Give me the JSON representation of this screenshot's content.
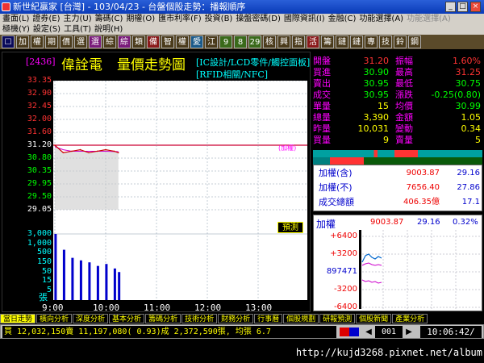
{
  "window": {
    "title": "新世紀贏家 [台灣] - 103/04/23 - 台盤個股走勢：播報順序",
    "btn_min": "_",
    "btn_max": "□",
    "btn_close": "×"
  },
  "menu1": [
    "畫面(L)",
    "證券(E)",
    "主力(U)",
    "籌碼(C)",
    "期權(O)",
    "匯市利率(F)",
    "投資(B)",
    "操盤密碼(D)",
    "國際資訊(I)",
    "金融(C)",
    "功能選擇(A)",
    "功能選擇(A)"
  ],
  "menu2": [
    "極機(Y)",
    "設定(S)",
    "工具(T)",
    "說明(H)"
  ],
  "toolbar": [
    {
      "t": "☐",
      "c": "#0a0a5a"
    },
    {
      "t": "加",
      "c": "#4a3a1a"
    },
    {
      "t": "權",
      "c": "#4a3a1a"
    },
    {
      "t": "期",
      "c": "#4a3a1a"
    },
    {
      "t": "價",
      "c": "#4a3a1a"
    },
    {
      "t": "選",
      "c": "#4a3a1a"
    },
    {
      "t": "選",
      "c": "#7a1a7a"
    },
    {
      "t": "綜",
      "c": "#4a3a1a"
    },
    {
      "t": "綜",
      "c": "#7a1a7a"
    },
    {
      "t": "類",
      "c": "#4a3a1a"
    },
    {
      "t": "備",
      "c": "#8a1a1a"
    },
    {
      "t": "智",
      "c": "#4a3a1a"
    },
    {
      "t": "權",
      "c": "#4a3a1a"
    },
    {
      "t": "愛",
      "c": "#1a5a8a"
    },
    {
      "t": "江",
      "c": "#4a3a1a"
    },
    {
      "t": "9",
      "c": "#3a6a1a"
    },
    {
      "t": "8",
      "c": "#3a6a1a"
    },
    {
      "t": "29",
      "c": "#3a6a1a"
    },
    {
      "t": "核",
      "c": "#4a3a1a"
    },
    {
      "t": "興",
      "c": "#4a3a1a"
    },
    {
      "t": "指",
      "c": "#4a3a1a"
    },
    {
      "t": "活",
      "c": "#8a1a1a"
    },
    {
      "t": "籌",
      "c": "#4a3a1a"
    },
    {
      "t": "鏈",
      "c": "#4a3a1a"
    },
    {
      "t": "鏈",
      "c": "#4a3a1a"
    },
    {
      "t": "專",
      "c": "#4a3a1a"
    },
    {
      "t": "技",
      "c": "#4a3a1a"
    },
    {
      "t": "鈴",
      "c": "#4a3a1a"
    },
    {
      "t": "鋼",
      "c": "#4a3a1a"
    }
  ],
  "chart": {
    "code": "[2436]",
    "name": "偉詮電",
    "title": "量價走勢圖",
    "tags1": "[IC設計/LCD零件/觸控面板]",
    "tags2": "[RFID相關/NFC]",
    "limit_label": "(加權)",
    "predict_label": "預測",
    "vol_unit": "張",
    "price_ticks": [
      "33.35",
      "32.90",
      "32.45",
      "32.00",
      "31.60",
      "31.20",
      "30.80",
      "30.35",
      "29.95",
      "29.50",
      "29.05"
    ],
    "vol_ticks": [
      "3,000",
      "1,000",
      "500",
      "150",
      "50",
      "15",
      "5"
    ],
    "times": [
      "9:00",
      "10:00",
      "11:00",
      "12:00",
      "13:00"
    ]
  },
  "chart_data": {
    "type": "line",
    "x": [
      "9:00",
      "9:10",
      "9:20",
      "9:30",
      "9:40",
      "9:50",
      "10:00",
      "10:10",
      "10:15"
    ],
    "series": [
      {
        "values": [
          31.2,
          30.95,
          31.0,
          31.05,
          30.95,
          31.0,
          31.05,
          31.0,
          30.95
        ]
      }
    ],
    "avg": [
      31.15,
      31.05,
      31.0,
      31.0,
      31.0,
      31.0,
      31.0,
      30.99,
      30.99
    ],
    "volume": [
      3000,
      500,
      200,
      150,
      120,
      80,
      100,
      60,
      40
    ],
    "ylim": [
      29.05,
      33.35
    ],
    "xlim": [
      "9:00",
      "13:30"
    ]
  },
  "stats": [
    {
      "l1": "開盤",
      "v1": "31.20",
      "c1": "#f33",
      "l2": "振幅",
      "v2": "1.60%",
      "c2": "#f33"
    },
    {
      "l1": "買進",
      "v1": "30.90",
      "c1": "#0f0",
      "l2": "最高",
      "v2": "31.25",
      "c2": "#f33"
    },
    {
      "l1": "賣出",
      "v1": "30.95",
      "c1": "#0f0",
      "l2": "最低",
      "v2": "30.75",
      "c2": "#0f0"
    },
    {
      "l1": "成交",
      "v1": "30.95",
      "c1": "#0f0",
      "l2": "漲跌",
      "v2": "-0.25(0.80)",
      "c2": "#0f0"
    },
    {
      "l1": "單量",
      "v1": "15",
      "c1": "#ff0",
      "l2": "均價",
      "v2": "30.99",
      "c2": "#0f0"
    },
    {
      "l1": "總量",
      "v1": "3,390",
      "c1": "#ff0",
      "l2": "金額",
      "v2": "1.05",
      "c2": "#ff0"
    },
    {
      "l1": "昨量",
      "v1": "10,031",
      "c1": "#ff0",
      "l2": "變動",
      "v2": "0.34",
      "c2": "#ff0"
    },
    {
      "l1": "買量",
      "v1": "9",
      "c1": "#ff0",
      "l2": "賣量",
      "v2": "5",
      "c2": "#ff0"
    }
  ],
  "index": [
    {
      "label": "加權(含)",
      "val": "9003.87",
      "chg": "29.16"
    },
    {
      "label": "加權(不)",
      "val": "7656.40",
      "chg": "27.86"
    },
    {
      "label": "成交總額",
      "val": "406.35億",
      "chg": "17.1"
    }
  ],
  "mini": {
    "label": "加權",
    "val": "9003.87",
    "chg": "29.16",
    "pct": "0.32%",
    "ticks": [
      "+6400",
      "+3200",
      "897471",
      "-3200",
      "-6400"
    ]
  },
  "tabs": [
    "當日走勢",
    "橫向分析",
    "深度分析",
    "基本分析",
    "籌碼分析",
    "技術分析",
    "財務分析",
    "行事曆",
    "個股規劃",
    "研報預測",
    "個股新聞",
    "產業分析"
  ],
  "status": {
    "ticker": "買 12,032,150賣 11,197,080( 0.93)成 2,372,590張, 均張 6.7",
    "page": "001",
    "time": "10:06:42/"
  },
  "watermark": "http://kujd3268.pixnet.net/album",
  "colors": {
    "up": "#f33",
    "down": "#0f0",
    "label": "#f0f",
    "axis": "#0ff",
    "warn": "#ff0"
  }
}
